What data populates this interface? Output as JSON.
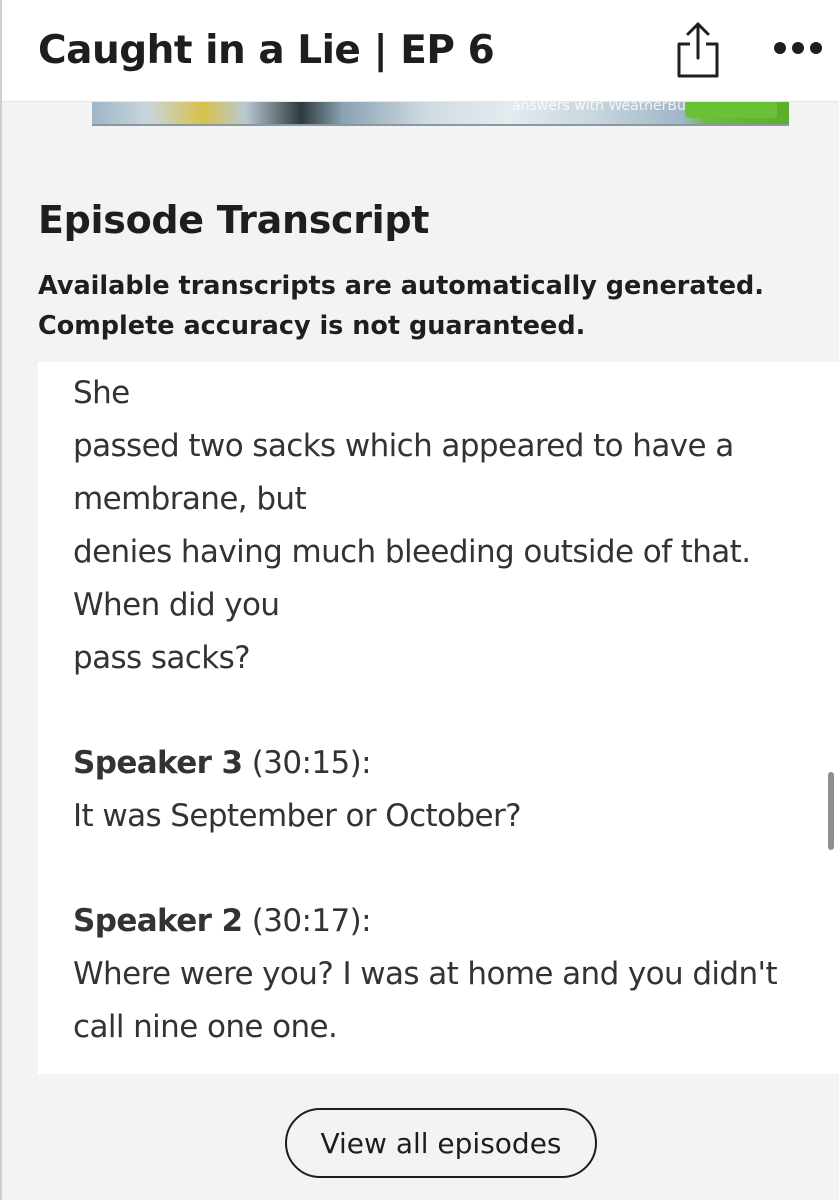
{
  "header": {
    "title": "Caught in a Lie | EP 6",
    "share_icon": "share-icon",
    "more_icon": "more-horizontal-icon"
  },
  "ad": {
    "partial_text": "answers with WeatherBug."
  },
  "transcript": {
    "heading": "Episode Transcript",
    "disclaimer_line1": "Available transcripts are automatically generated.",
    "disclaimer_line2": "Complete accuracy is not guaranteed.",
    "lines": [
      "She",
      "passed two sacks which appeared to have a",
      "membrane, but",
      "denies having much bleeding outside of that.",
      "When did you",
      "pass sacks?"
    ],
    "entries": [
      {
        "speaker": "Speaker 3",
        "time": "(30:15):",
        "lines": [
          "It was September or October?"
        ]
      },
      {
        "speaker": "Speaker 2",
        "time": "(30:17):",
        "lines": [
          "Where were you? I was at home and you didn't",
          "call nine one one."
        ]
      }
    ]
  },
  "footer": {
    "view_all_label": "View all episodes"
  },
  "colors": {
    "accent_green": "#69c235",
    "text": "#1e1e1e",
    "transcript_text": "#333333"
  }
}
